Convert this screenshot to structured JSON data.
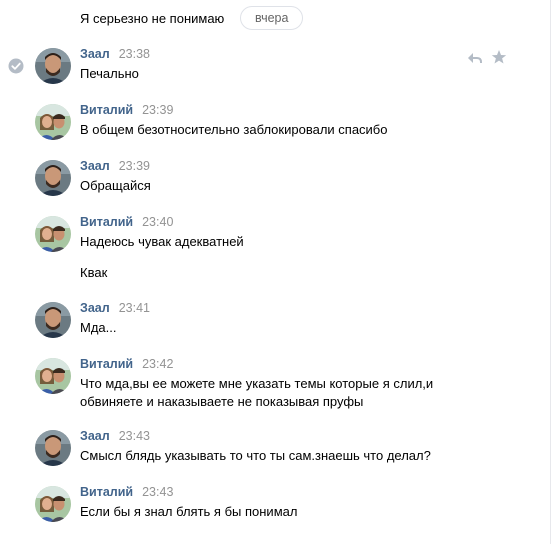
{
  "top": {
    "text": "Я серьезно не понимаю",
    "date_label": "вчера"
  },
  "icons": {
    "read": "check-circle-icon",
    "reply": "reply-icon",
    "favorite": "star-icon"
  },
  "colors": {
    "name": "#42648b",
    "time": "#939393",
    "icon": "#b4bcc6",
    "pill_border": "#dfe2e8"
  },
  "messages": [
    {
      "author": "Заал",
      "time": "23:38",
      "lines": [
        "Печально"
      ]
    },
    {
      "author": "Виталий",
      "time": "23:39",
      "lines": [
        "В общем безотносительно заблокировали спасибо"
      ]
    },
    {
      "author": "Заал",
      "time": "23:39",
      "lines": [
        "Обращайся"
      ]
    },
    {
      "author": "Виталий",
      "time": "23:40",
      "lines": [
        "Надеюсь чувак адекватней",
        "Квак"
      ]
    },
    {
      "author": "Заал",
      "time": "23:41",
      "lines": [
        "Мда..."
      ]
    },
    {
      "author": "Виталий",
      "time": "23:42",
      "lines": [
        "Что мда,вы ее можете мне указать темы которые я слил,и обвиняете и наказываете не показывая пруфы"
      ]
    },
    {
      "author": "Заал",
      "time": "23:43",
      "lines": [
        "Смысл блядь указывать то что ты сам.знаешь что делал?"
      ]
    },
    {
      "author": "Виталий",
      "time": "23:43",
      "lines": [
        "Если бы я знал блять я бы понимал"
      ]
    }
  ]
}
